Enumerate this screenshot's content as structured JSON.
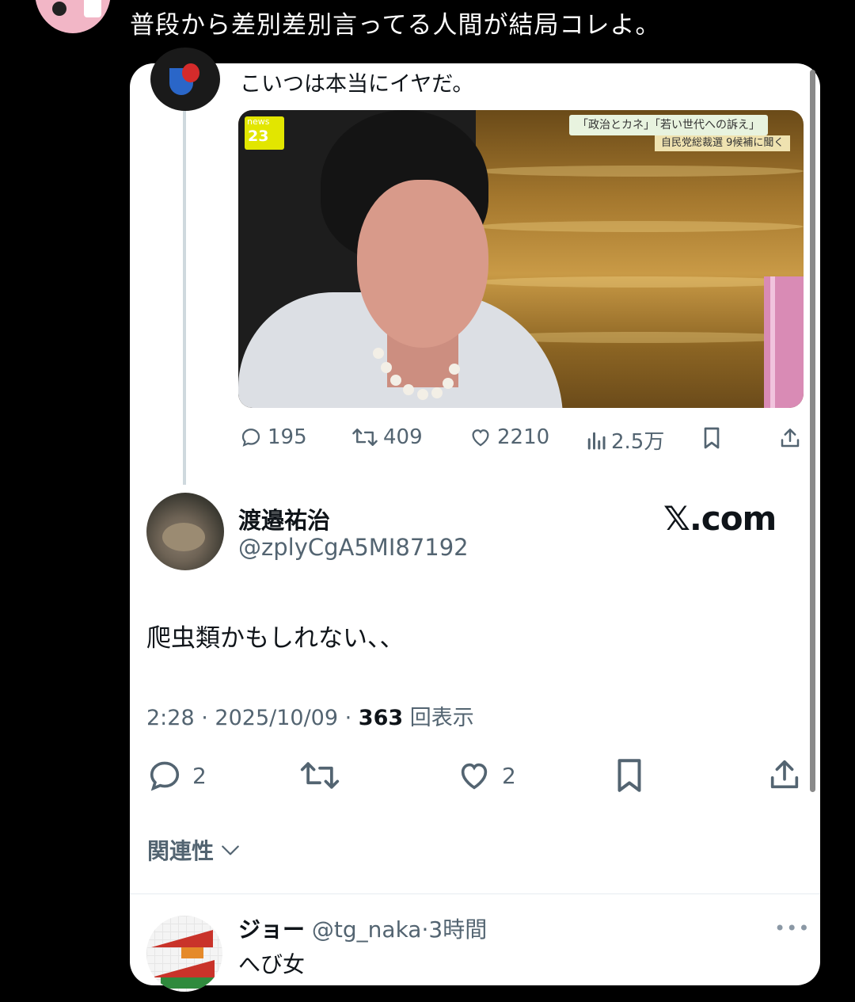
{
  "outer_post": {
    "text": "普段から差別差別言ってる人間が結局コレよ。"
  },
  "quoted_post": {
    "text": "こいつは本当にイヤだ。",
    "tv_image": {
      "logo_top": "news",
      "logo_bottom": "23",
      "caption_line1": "「政治とカネ」「若い世代への訴え」",
      "caption_line2": "自民党総裁選 9候補に聞く"
    },
    "metrics": {
      "replies": "195",
      "reposts": "409",
      "likes": "2210",
      "views": "2.5万"
    }
  },
  "reply_post": {
    "display_name": "渡邉祐治",
    "handle": "@zplyCgA5MI87192",
    "site_label": "𝕏.com",
    "text": "爬虫類かもしれない、、",
    "time": "2:28",
    "date": "2025/10/09",
    "views": "363",
    "views_suffix": "回表示",
    "actions": {
      "replies": "2",
      "likes": "2"
    },
    "related_label": "関連性"
  },
  "next_reply": {
    "display_name": "ジョー",
    "handle": "@tg_naka",
    "time_ago": "3時間",
    "text": "へび女",
    "more": "•••"
  },
  "colors": {
    "background": "#000000",
    "card": "#ffffff",
    "text_primary": "#0f1419",
    "text_secondary": "#536471"
  }
}
